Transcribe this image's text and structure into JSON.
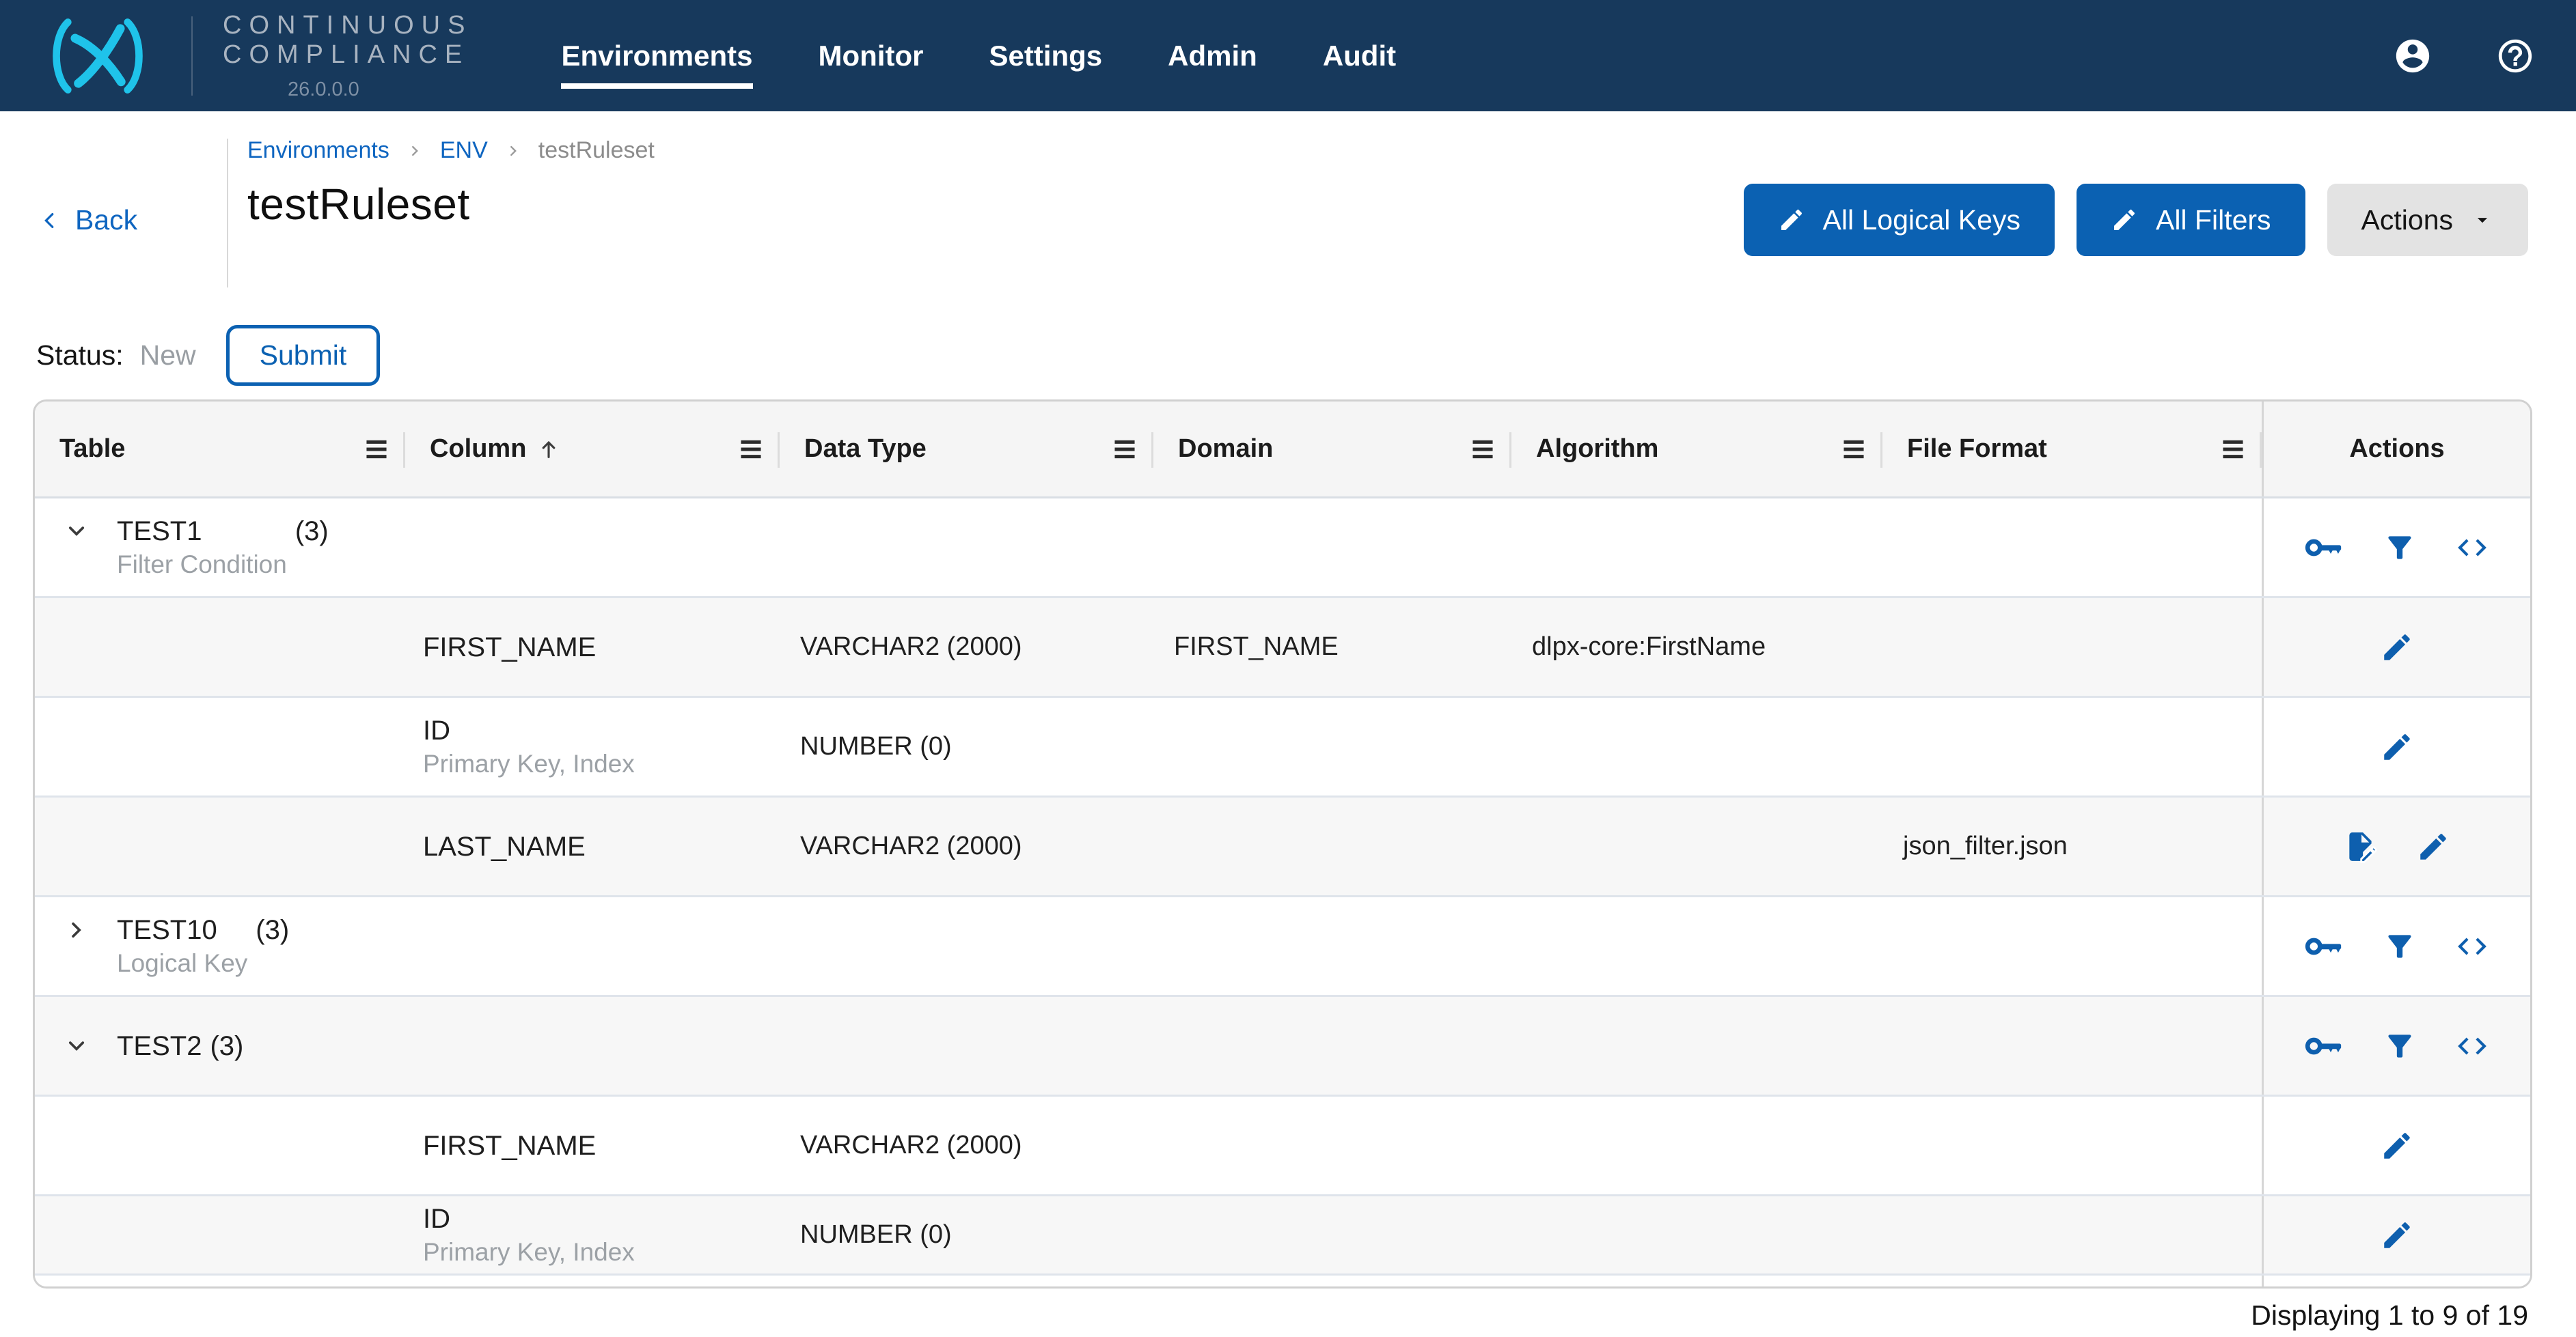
{
  "nav": {
    "brand_line1": "CONTINUOUS",
    "brand_line2": "COMPLIANCE",
    "version": "26.0.0.0",
    "items": [
      {
        "label": "Environments",
        "active": true
      },
      {
        "label": "Monitor",
        "active": false
      },
      {
        "label": "Settings",
        "active": false
      },
      {
        "label": "Admin",
        "active": false
      },
      {
        "label": "Audit",
        "active": false
      }
    ]
  },
  "header": {
    "back_label": "Back",
    "breadcrumb": [
      {
        "label": "Environments",
        "current": false
      },
      {
        "label": "ENV",
        "current": false
      },
      {
        "label": "testRuleset",
        "current": true
      }
    ],
    "title": "testRuleset",
    "buttons": [
      {
        "label": "All Logical Keys",
        "icon": "edit",
        "style": "primary"
      },
      {
        "label": "All Filters",
        "icon": "edit",
        "style": "primary"
      },
      {
        "label": "Actions",
        "icon": "caret-down",
        "style": "secondary"
      }
    ]
  },
  "status": {
    "label": "Status:",
    "value": "New",
    "action_label": "Submit"
  },
  "grid": {
    "columns": [
      {
        "label": "Table",
        "menu": true,
        "sorted": null
      },
      {
        "label": "Column",
        "menu": true,
        "sorted": "asc"
      },
      {
        "label": "Data Type",
        "menu": true,
        "sorted": null
      },
      {
        "label": "Domain",
        "menu": true,
        "sorted": null
      },
      {
        "label": "Algorithm",
        "menu": true,
        "sorted": null
      },
      {
        "label": "File Format",
        "menu": true,
        "sorted": null
      },
      {
        "label": "Actions",
        "menu": false,
        "sorted": null
      }
    ],
    "rows": [
      {
        "type": "group",
        "name": "TEST1",
        "count": "(3)",
        "subtitle": "Filter Condition",
        "expanded": true,
        "actions": [
          "key",
          "filter",
          "code"
        ]
      },
      {
        "type": "column",
        "column": "FIRST_NAME",
        "subtitle": "",
        "data_type": "VARCHAR2 (2000)",
        "domain": "FIRST_NAME",
        "algorithm": "dlpx-core:FirstName",
        "file_format": "",
        "actions": [
          "edit"
        ]
      },
      {
        "type": "column",
        "column": "ID",
        "subtitle": "Primary Key, Index",
        "data_type": "NUMBER (0)",
        "domain": "",
        "algorithm": "",
        "file_format": "",
        "actions": [
          "edit"
        ]
      },
      {
        "type": "column",
        "column": "LAST_NAME",
        "subtitle": "",
        "data_type": "VARCHAR2 (2000)",
        "domain": "",
        "algorithm": "",
        "file_format": "json_filter.json",
        "actions": [
          "edit-document",
          "edit"
        ]
      },
      {
        "type": "group",
        "name": "TEST10",
        "count": "(3)",
        "subtitle": "Logical Key",
        "expanded": false,
        "actions": [
          "key",
          "filter",
          "code"
        ]
      },
      {
        "type": "group",
        "name": "TEST2",
        "count": "(3)",
        "subtitle": "",
        "expanded": true,
        "actions": [
          "key",
          "filter",
          "code"
        ]
      },
      {
        "type": "column",
        "column": "FIRST_NAME",
        "subtitle": "",
        "data_type": "VARCHAR2 (2000)",
        "domain": "",
        "algorithm": "",
        "file_format": "",
        "actions": [
          "edit"
        ]
      },
      {
        "type": "column",
        "column": "ID",
        "subtitle": "Primary Key, Index",
        "data_type": "NUMBER (0)",
        "domain": "",
        "algorithm": "",
        "file_format": "",
        "actions": [
          "edit"
        ]
      }
    ],
    "footer": "Displaying 1 to 9 of 19"
  },
  "colors": {
    "navy": "#17395C",
    "cyan": "#1FC3EA",
    "link": "#0E65C0",
    "btn": "#0B61B2",
    "icon": "#0E5FAE"
  }
}
